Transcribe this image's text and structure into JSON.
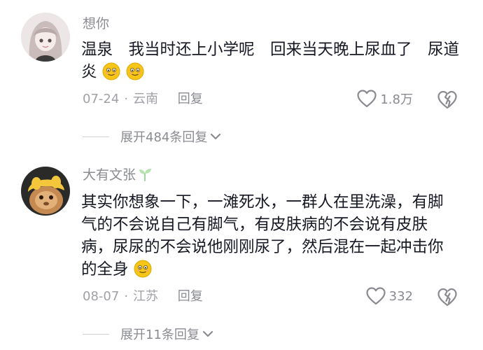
{
  "comments": [
    {
      "username": "想你",
      "lines": [
        "温泉　我当时还上小学呢　回来当天晚上尿血了　尿道",
        "炎"
      ],
      "emojis_after_text": [
        "smile-emoji",
        "smile-emoji"
      ],
      "date": "07-24",
      "location": "云南",
      "reply_label": "回复",
      "likes": "1.8万",
      "expand_label": "展开484条回复"
    },
    {
      "username": "大有文张",
      "lines": [
        "其实你想象一下，一滩死水，一群人在里洗澡，有脚",
        "气的不会说自己有脚气，有皮肤病的不会说有皮肤",
        "病，尿尿的不会说他刚刚尿了，然后混在一起冲击你",
        "的全身"
      ],
      "emojis_after_text": [
        "smile-emoji"
      ],
      "date": "08-07",
      "location": "江苏",
      "reply_label": "回复",
      "likes": "332",
      "expand_label": "展开11条回复"
    }
  ],
  "colors": {
    "text": "#161823",
    "muted": "#8a8b91",
    "meta": "#a0a1a6",
    "emoji": "#f5c518"
  },
  "separator": "·"
}
